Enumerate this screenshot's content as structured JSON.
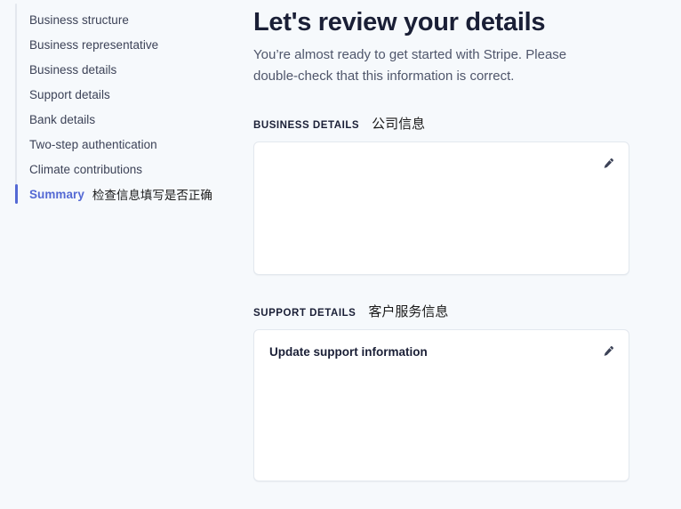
{
  "theme": {
    "background": "#f6f9fc",
    "accent": "#5469d4",
    "text_dark": "#1a1f36",
    "text_muted": "#4f566b",
    "card_background": "#ffffff",
    "card_border": "#e3e8ee",
    "rail": "#e3e8ee",
    "annotation": "#1a1a1a"
  },
  "sidebar": {
    "items": [
      {
        "label": "Business structure",
        "active": false,
        "annotation": ""
      },
      {
        "label": "Business representative",
        "active": false,
        "annotation": ""
      },
      {
        "label": "Business details",
        "active": false,
        "annotation": ""
      },
      {
        "label": "Support details",
        "active": false,
        "annotation": ""
      },
      {
        "label": "Bank details",
        "active": false,
        "annotation": ""
      },
      {
        "label": "Two-step authentication",
        "active": false,
        "annotation": ""
      },
      {
        "label": "Climate contributions",
        "active": false,
        "annotation": ""
      },
      {
        "label": "Summary",
        "active": true,
        "annotation": "检查信息填写是否正确"
      }
    ]
  },
  "main": {
    "title": "Let's review your details",
    "subtitle": "You’re almost ready to get started with Stripe. Please double-check that this information is correct.",
    "sections": [
      {
        "label": "BUSINESS DETAILS",
        "annotation": "公司信息",
        "card": {
          "row_label": "",
          "edit_icon": "pencil-icon"
        }
      },
      {
        "label": "SUPPORT DETAILS",
        "annotation": "客户服务信息",
        "card": {
          "row_label": "Update support information",
          "edit_icon": "pencil-icon"
        }
      }
    ]
  }
}
